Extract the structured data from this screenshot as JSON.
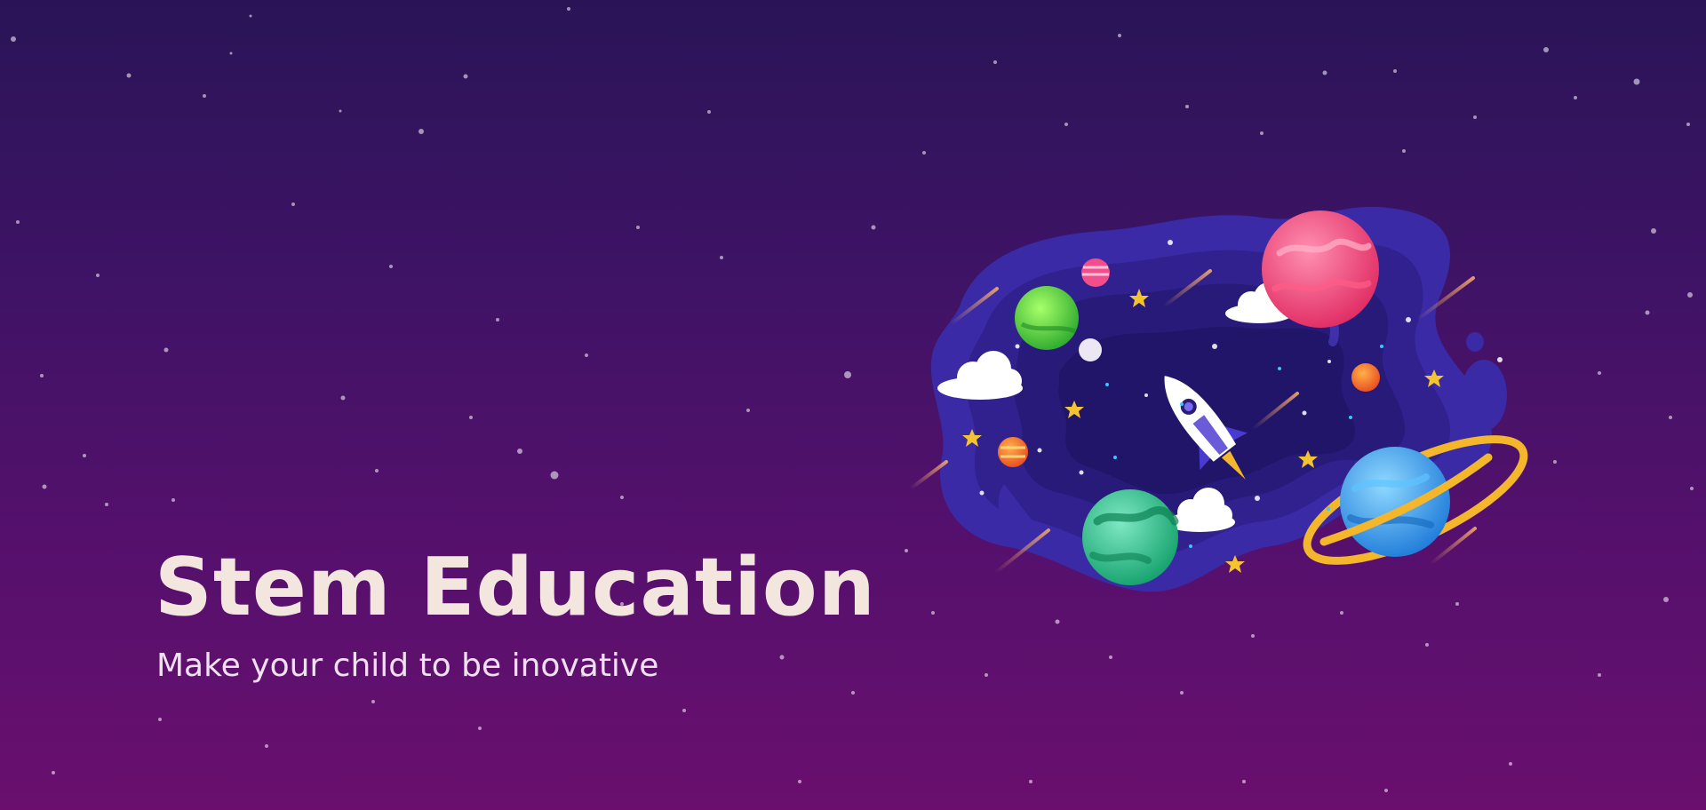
{
  "hero": {
    "title": "Stem Education",
    "subtitle": "Make your child to be inovative"
  },
  "illustration": {
    "elements": [
      "rocket-icon",
      "planet-pink",
      "planet-green",
      "planet-earth",
      "planet-blue-ringed",
      "planet-small-pink",
      "planet-small-white",
      "planet-small-orange",
      "planet-small-red",
      "cloud",
      "star",
      "comet"
    ]
  },
  "colors": {
    "background_top": "#2a1457",
    "background_bottom": "#6a0f6e",
    "title": "#f3e6df",
    "subtitle": "#efe1f0",
    "blob": "#3b2aa6",
    "ring": "#f4b62a"
  }
}
